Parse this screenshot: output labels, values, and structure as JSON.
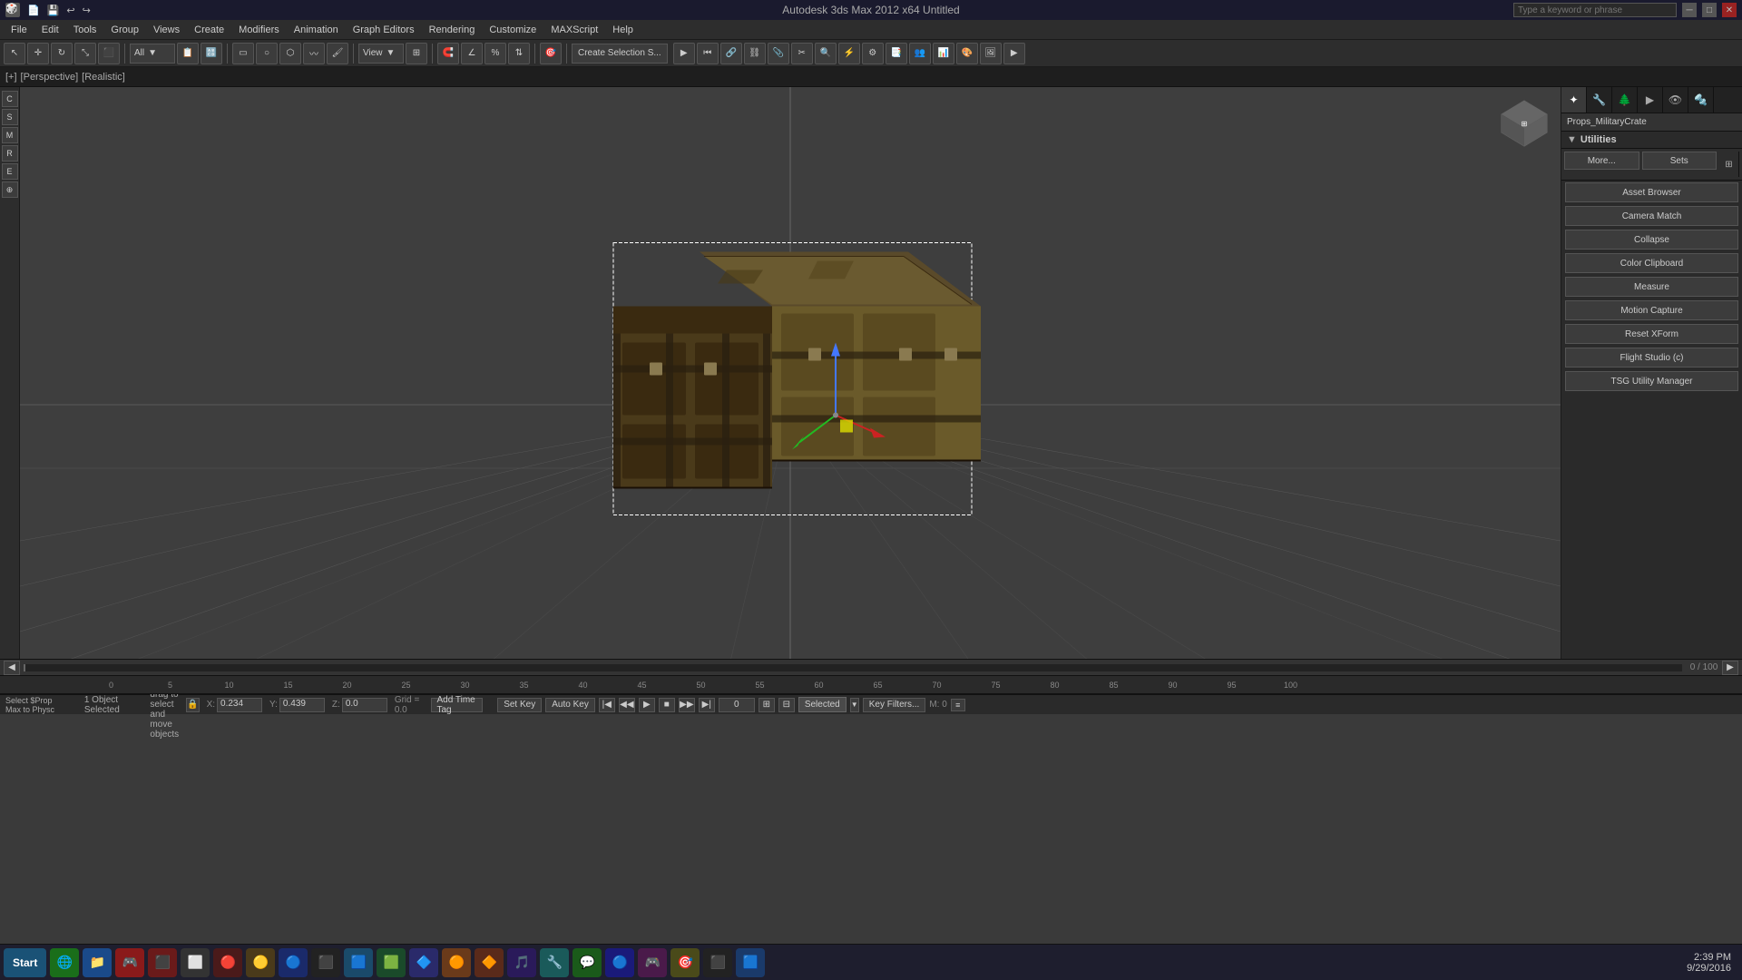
{
  "titleBar": {
    "title": "Autodesk 3ds Max 2012 x64    Untitled",
    "searchPlaceholder": "Type a keyword or phrase"
  },
  "menuBar": {
    "items": [
      "File",
      "Edit",
      "Tools",
      "Group",
      "Views",
      "Create",
      "Modifiers",
      "Animation",
      "Graph Editors",
      "Rendering",
      "Customize",
      "MAXScript",
      "Help"
    ]
  },
  "toolbar": {
    "viewDropdown": "View",
    "createSelection": "Create Selection S...",
    "allLabel": "All"
  },
  "viewport": {
    "labels": [
      "[+]",
      "[Perspective]",
      "[Realistic]"
    ]
  },
  "rightPanel": {
    "objectName": "Props_MilitaryCrate",
    "utilitiesTitle": "Utilities",
    "moreBtn": "More...",
    "setsBtn": "Sets",
    "buttons": [
      "Asset Browser",
      "Camera Match",
      "Collapse",
      "Color Clipboard",
      "Measure",
      "Motion Capture",
      "Reset XForm",
      "Flight Studio (c)",
      "TSG Utility Manager"
    ]
  },
  "statusBar": {
    "leftTop": "Select $Prop",
    "leftBottom": "Max to Physc",
    "message": "Click and drag to select and move objects",
    "objectsSelected": "1 Object Selected",
    "coordX": {
      "label": "X:",
      "value": "0.234"
    },
    "coordY": {
      "label": "Y:",
      "value": "0.439"
    },
    "coordZ": {
      "label": "Z:",
      "value": "0.0"
    },
    "gridLabel": "Grid = 0.0",
    "setKeyLabel": "Set Key",
    "autoKeyLabel": "Auto Key",
    "selectedLabel": "Selected",
    "keyFiltersLabel": "Key Filters...",
    "addTimeTagLabel": "Add Time Tag"
  },
  "timeline": {
    "frameStart": "0",
    "frameEnd": "100",
    "frameMarkers": [
      "0",
      "5",
      "10",
      "15",
      "20",
      "25",
      "30",
      "35",
      "40",
      "45",
      "50",
      "55",
      "60",
      "65",
      "70",
      "75",
      "80",
      "85",
      "90",
      "95",
      "100"
    ]
  },
  "taskbar": {
    "startLabel": "Start",
    "time": "2:39 PM",
    "date": "9/29/2016",
    "apps": [
      "🌐",
      "📁",
      "🎮",
      "🔴",
      "⬜",
      "🔴",
      "🟡",
      "🔵",
      "⬛",
      "🟦",
      "🟩",
      "🔷",
      "🟠",
      "🔶",
      "🎵",
      "🔧",
      "💬",
      "🔵",
      "🎮",
      "🎯",
      "⬛",
      "🟦"
    ]
  },
  "animControls": {
    "frameNum": "0",
    "miLabel": "M: 0"
  }
}
